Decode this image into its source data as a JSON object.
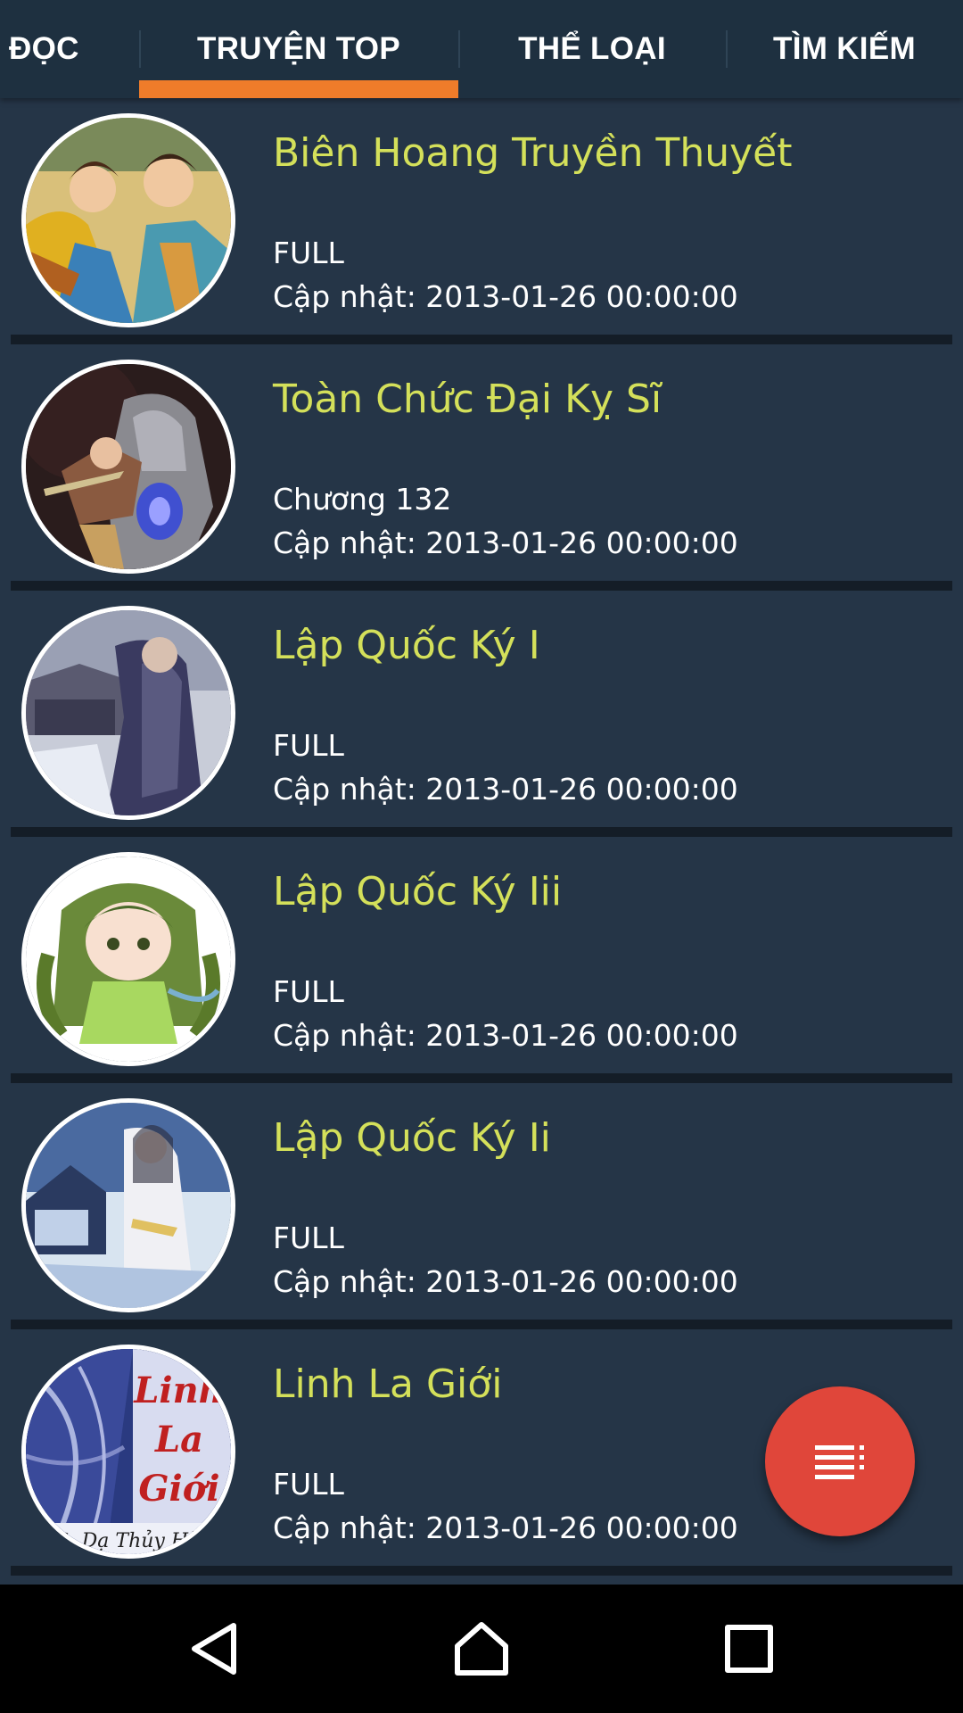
{
  "tabs": [
    {
      "label": "ĐỌC"
    },
    {
      "label": "TRUYỆN TOP"
    },
    {
      "label": "THỂ LOẠI"
    },
    {
      "label": "TÌM KIẾM"
    }
  ],
  "active_tab": "TRUYỆN TOP",
  "colors": {
    "background": "#253547",
    "tabbar": "#1e3040",
    "accent": "#ef7c2a",
    "title": "#d4e05a",
    "fab": "#e0463a"
  },
  "stories": [
    {
      "title": "Biên Hoang Truyền Thuyết",
      "status": "FULL",
      "updated": "Cập nhật: 2013-01-26 00:00:00"
    },
    {
      "title": "Toàn Chức Đại Kỵ Sĩ",
      "status": "Chương 132",
      "updated": "Cập nhật: 2013-01-26 00:00:00"
    },
    {
      "title": "Lập Quốc Ký I",
      "status": "FULL",
      "updated": "Cập nhật: 2013-01-26 00:00:00"
    },
    {
      "title": "Lập Quốc Ký Iii",
      "status": "FULL",
      "updated": "Cập nhật: 2013-01-26 00:00:00"
    },
    {
      "title": "Lập Quốc Ký Ii",
      "status": "FULL",
      "updated": "Cập nhật: 2013-01-26 00:00:00"
    },
    {
      "title": "Linh La Giới",
      "status": "FULL",
      "updated": "Cập nhật: 2013-01-26 00:00:00",
      "cover_text": [
        "Linh",
        "La",
        "Giới",
        "TG: Dạ Thủy Hàn"
      ]
    }
  ],
  "fab": {
    "icon": "playlist-icon"
  },
  "navbar": {
    "icons": [
      "back-icon",
      "home-icon",
      "recents-icon"
    ]
  }
}
